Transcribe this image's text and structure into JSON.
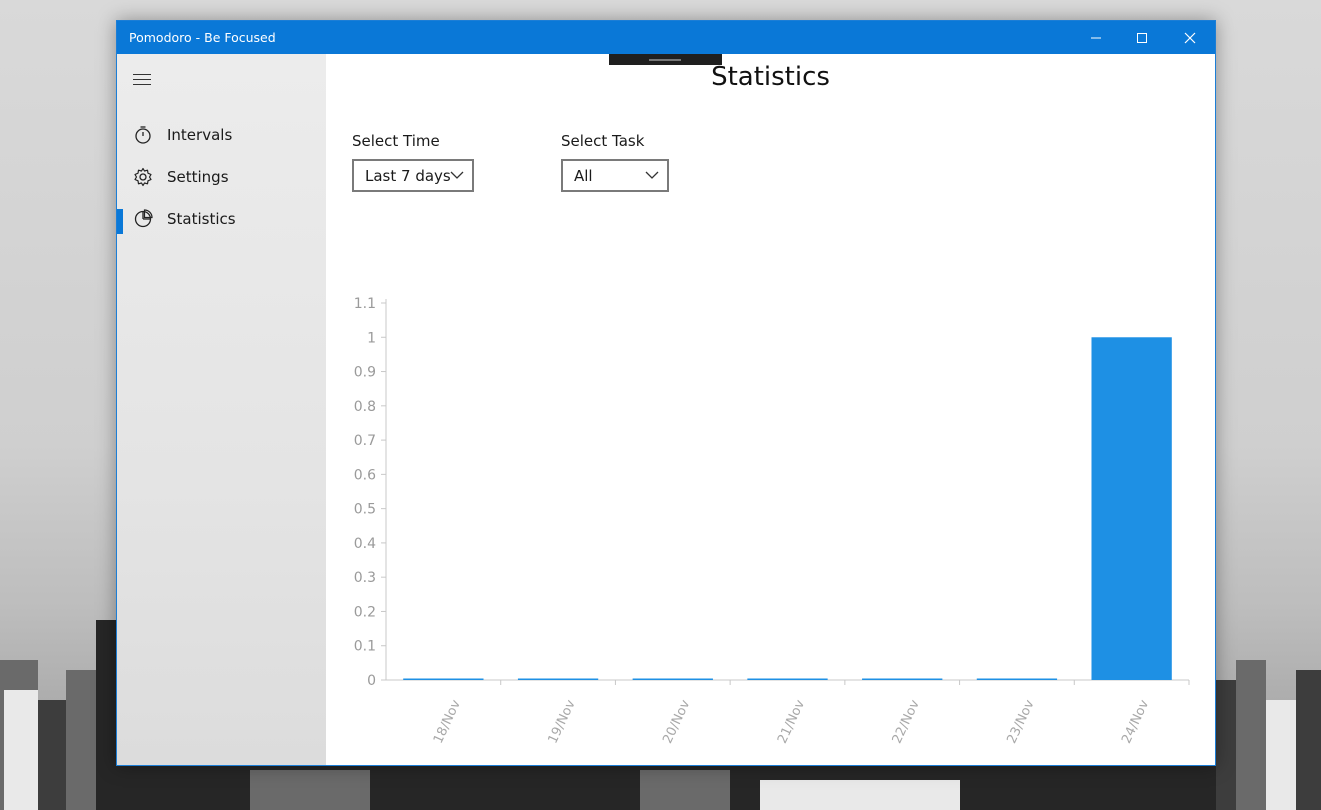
{
  "window": {
    "title": "Pomodoro - Be Focused",
    "accent_color": "#0a78d7"
  },
  "sidebar": {
    "menu_icon": "hamburger-icon",
    "items": [
      {
        "label": "Intervals",
        "icon": "stopwatch-icon",
        "selected": false
      },
      {
        "label": "Settings",
        "icon": "gear-icon",
        "selected": false
      },
      {
        "label": "Statistics",
        "icon": "pie-chart-icon",
        "selected": true
      }
    ]
  },
  "main": {
    "title": "Statistics",
    "select_time": {
      "label": "Select Time",
      "value": "Last 7 days"
    },
    "select_task": {
      "label": "Select Task",
      "value": "All"
    }
  },
  "chart_data": {
    "type": "bar",
    "categories": [
      "18/Nov",
      "19/Nov",
      "20/Nov",
      "21/Nov",
      "22/Nov",
      "23/Nov",
      "24/Nov"
    ],
    "values": [
      0,
      0,
      0,
      0,
      0,
      0,
      1
    ],
    "ylim": [
      0,
      1.1
    ],
    "yticks": [
      "0",
      "0.1",
      "0.2",
      "0.3",
      "0.4",
      "0.5",
      "0.6",
      "0.7",
      "0.8",
      "0.9",
      "1",
      "1.1"
    ],
    "bar_color": "#1e90e4",
    "grid": false
  }
}
